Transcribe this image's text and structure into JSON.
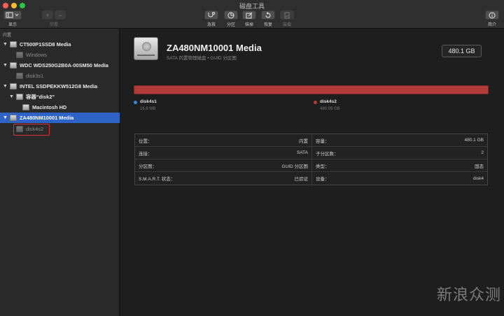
{
  "window": {
    "title": "磁盘工具"
  },
  "toolbar": {
    "view_label": "显示",
    "volume_label": "宗卷",
    "add_symbol": "+",
    "remove_symbol": "−",
    "first_aid_label": "急救",
    "partition_label": "分区",
    "erase_label": "抹掉",
    "restore_label": "恢复",
    "mount_label": "装载",
    "info_label": "简介"
  },
  "sidebar": {
    "section": "内置",
    "items": [
      {
        "label": "CT500P1SSD8 Media"
      },
      {
        "label": "Windows"
      },
      {
        "label": "WDC WDS250G2B0A-00SM50 Media"
      },
      {
        "label": "disk3s1"
      },
      {
        "label": "INTEL SSDPEKKW512G8 Media"
      },
      {
        "label": "容器“disk2”"
      },
      {
        "label": "Macintosh HD"
      },
      {
        "label": "ZA480NM10001 Media"
      },
      {
        "label": "disk4s2"
      }
    ]
  },
  "disk": {
    "name": "ZA480NM10001 Media",
    "subtitle": "SATA 内置物理磁盘 • GUID 分区图",
    "size": "480.1 GB"
  },
  "partitions": [
    {
      "name": "disk4s1",
      "size": "16.8 MB",
      "color": "#3c88d0"
    },
    {
      "name": "disk4s2",
      "size": "480.09 GB",
      "color": "#b23c3a"
    }
  ],
  "info": {
    "left": [
      {
        "key": "位置：",
        "value": "内置"
      },
      {
        "key": "连接：",
        "value": "SATA"
      },
      {
        "key": "分区图：",
        "value": "GUID 分区图"
      },
      {
        "key": "S.M.A.R.T. 状态：",
        "value": "已验证"
      }
    ],
    "right": [
      {
        "key": "容量：",
        "value": "480.1 GB"
      },
      {
        "key": "子分区数：",
        "value": "2"
      },
      {
        "key": "类型：",
        "value": "固态"
      },
      {
        "key": "设备：",
        "value": "disk4"
      }
    ]
  },
  "watermark": "新浪众测"
}
